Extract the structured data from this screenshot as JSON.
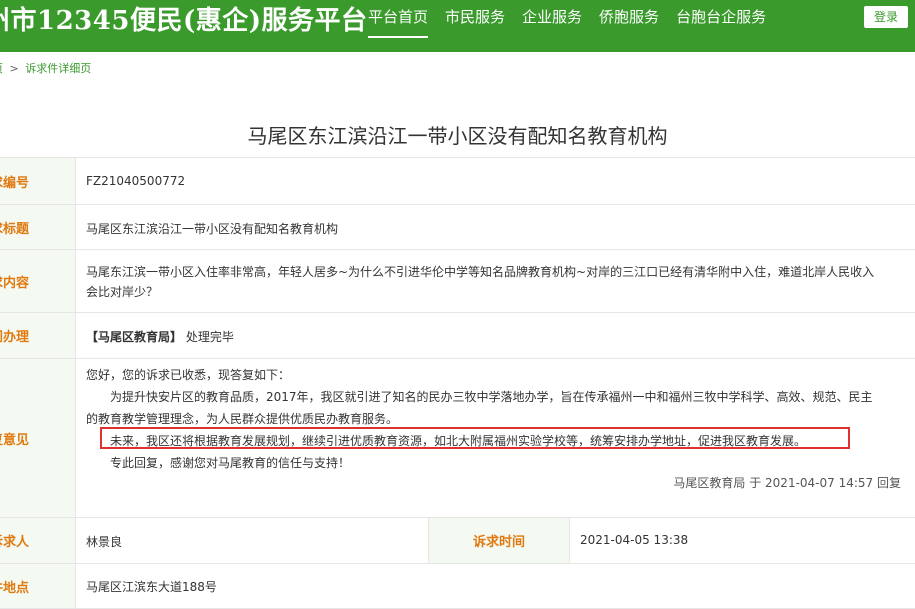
{
  "header": {
    "site_title": "州市12345便民(惠企)服务平台",
    "nav": [
      "平台首页",
      "市民服务",
      "企业服务",
      "侨胞服务",
      "台胞台企服务"
    ],
    "login": "登录"
  },
  "breadcrumb": {
    "home": "页",
    "sep": ">",
    "current": "诉求件详细页"
  },
  "page_title": "马尾区东江滨沿江一带小区没有配知名教育机构",
  "rows": {
    "number": {
      "label": "求编号",
      "value": "FZ21040500772"
    },
    "title": {
      "label": "求标题",
      "value": "马尾区东江滨沿江一带小区没有配知名教育机构"
    },
    "content": {
      "label": "求内容",
      "line1": "马尾东江滨一带小区入住率非常高，年轻人居多~为什么不引进华伦中学等知名品牌教育机构~对岸的三江口已经有清华附中入住，难道北岸人民收入",
      "line2": "会比对岸少？"
    },
    "dept": {
      "label": "门办理",
      "dept_name": "【马尾区教育局】",
      "status": "处理完毕"
    },
    "reply": {
      "label": "复意见",
      "line1": "您好，您的诉求已收悉，现答复如下：",
      "line2": "为提升快安片区的教育品质，2017年，我区就引进了知名的民办三牧中学落地办学，旨在传承福州一中和福州三牧中学科学、高效、规范、民主",
      "line3": "的教育教学管理理念，为人民群众提供优质民办教育服务。",
      "line4": "未来，我区还将根据教育发展规划，继续引进优质教育资源，如北大附属福州实验学校等，统筹安排办学地址，促进我区教育发展。",
      "line5": "专此回复，感谢您对马尾教育的信任与支持！",
      "signature": "马尾区教育局 于 2021-04-07 14:57 回复"
    },
    "petitioner": {
      "label": "诉求人",
      "value": "林景良",
      "time_label": "诉求时间",
      "time_value": "2021-04-05 13:38"
    },
    "location": {
      "label": "件地点",
      "value": "马尾区江滨东大道188号"
    }
  },
  "colors": {
    "header_green": "#3a9a2c",
    "label_orange": "#e07a10",
    "highlight_red": "#e03131"
  }
}
